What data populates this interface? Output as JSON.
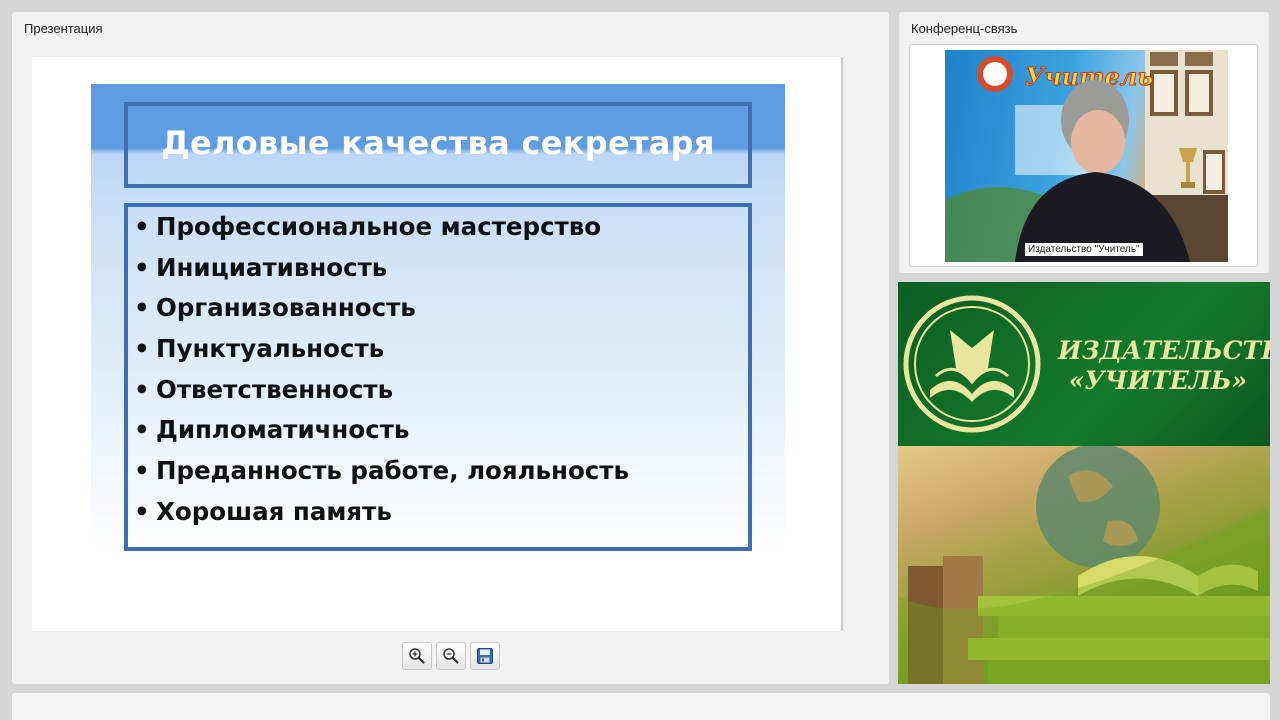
{
  "presentation_panel": {
    "title": "Презентация",
    "slide": {
      "title": "Деловые качества секретаря",
      "bullets": [
        "Профессиональное мастерство",
        "Инициативность",
        "Организованность",
        "Пунктуальность",
        "Ответственность",
        "Дипломатичность",
        "Преданность работе, лояльность",
        "Хорошая память"
      ],
      "bullet_symbol": "•"
    },
    "toolbar": {
      "buttons": [
        {
          "name": "zoom-in",
          "icon": "zoom-in-icon"
        },
        {
          "name": "zoom-out",
          "icon": "zoom-out-icon"
        },
        {
          "name": "save",
          "icon": "save-icon"
        }
      ]
    }
  },
  "conference_panel": {
    "title": "Конференц-связь",
    "participant_name": "Издательство \"Учитель\"",
    "background_sign": "Учитель"
  },
  "banner": {
    "publisher_line1": "ИЗДАТЕЛЬСТВО",
    "publisher_line2": "«УЧИТЕЛЬ»"
  },
  "colors": {
    "slide_frame": "#3f6fb3",
    "slide_header": "#5f9ce2",
    "banner_green": "#147a2c",
    "banner_text": "#e9e6a0"
  }
}
